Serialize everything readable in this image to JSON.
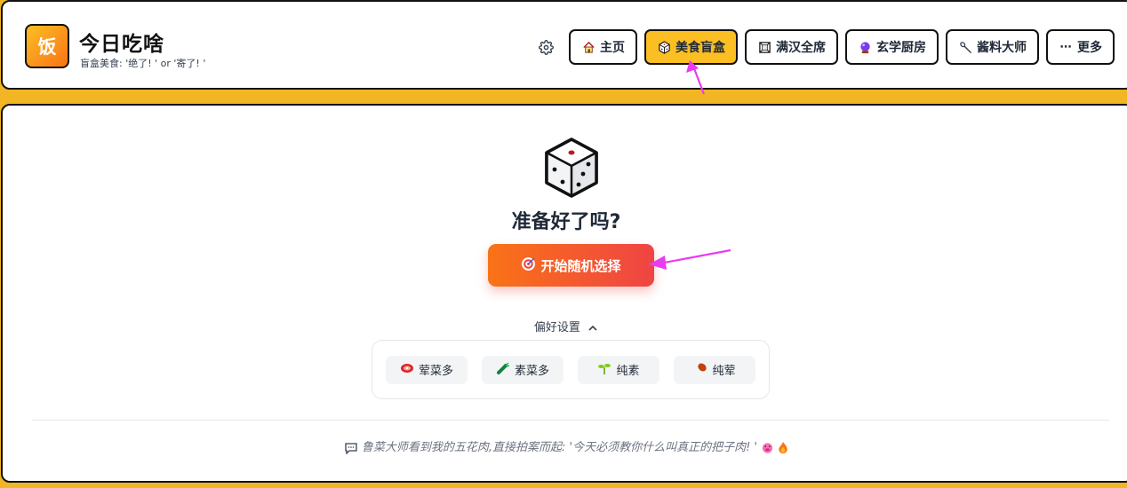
{
  "header": {
    "logo_text": "饭",
    "title": "今日吃啥",
    "subtitle": "盲盒美食: '绝了! ' or '寄了! '",
    "nav": [
      {
        "label": "主页",
        "icon": "house-icon",
        "active": false
      },
      {
        "label": "美食盲盒",
        "icon": "dice-icon",
        "active": true
      },
      {
        "label": "满汉全席",
        "icon": "frame-icon",
        "active": false
      },
      {
        "label": "玄学厨房",
        "icon": "crystal-ball-icon",
        "active": false
      },
      {
        "label": "酱料大师",
        "icon": "spoon-icon",
        "active": false
      },
      {
        "label": "更多",
        "icon": "ellipsis-icon",
        "active": false
      }
    ]
  },
  "main": {
    "ready_text": "准备好了吗?",
    "start_button": "开始随机选择",
    "pref_toggle": "偏好设置",
    "preferences": [
      {
        "label": "荤菜多",
        "icon": "meat-icon"
      },
      {
        "label": "素菜多",
        "icon": "vegetable-icon"
      },
      {
        "label": "纯素",
        "icon": "sprout-icon"
      },
      {
        "label": "纯荤",
        "icon": "drumstick-icon"
      }
    ],
    "quote": "鲁菜大师看到我的五花肉,直接拍案而起: '今天必须教你什么叫真正的把子肉! '"
  },
  "colors": {
    "background": "#f2b524",
    "accent": "#fbbf24",
    "start_gradient": [
      "#f97316",
      "#ef4444"
    ],
    "annotation_arrow": "#e83cf0"
  }
}
